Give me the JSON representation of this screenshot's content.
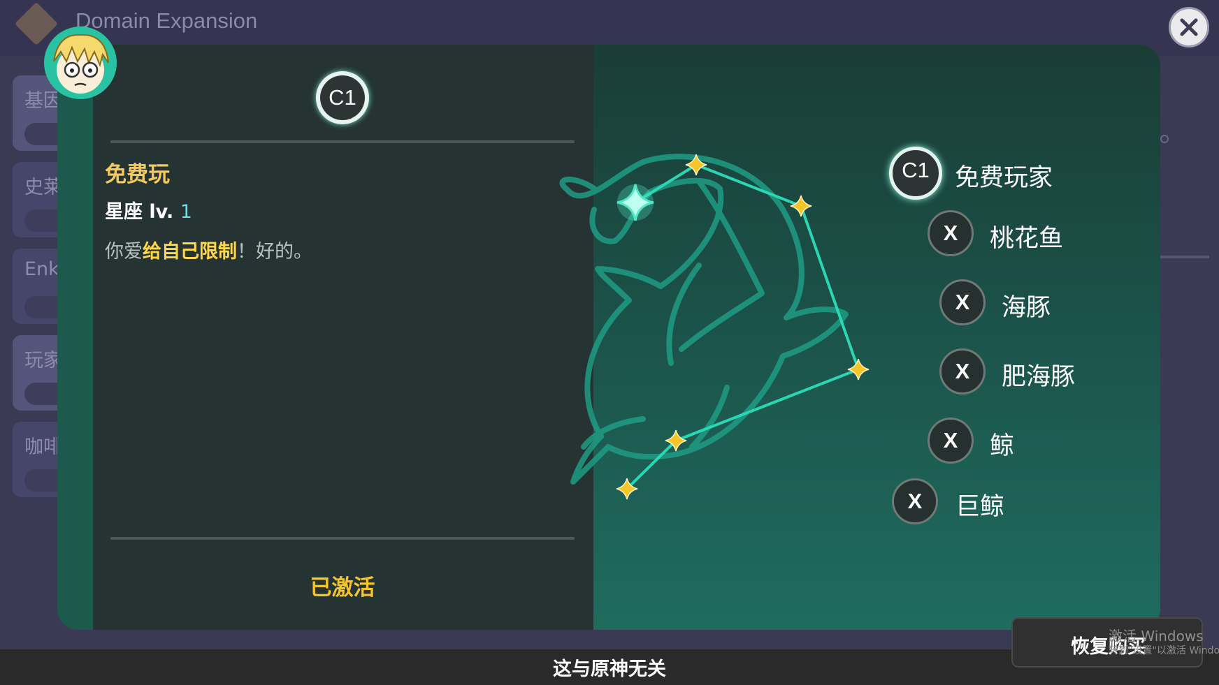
{
  "app": {
    "title": "Domain Expansion"
  },
  "sidebar": {
    "items": [
      {
        "label": "基因"
      },
      {
        "label": "史莱"
      },
      {
        "label": "Enk"
      },
      {
        "label": "玩家"
      },
      {
        "label": "咖啡"
      }
    ]
  },
  "detail": {
    "badge": "C1",
    "name": "免费玩",
    "level_label": "星座 lv.",
    "level_value": "1",
    "description": {
      "pre": "你爱",
      "highlight": "给自己限制",
      "post": "！好的。"
    },
    "status": "已激活"
  },
  "constellations": [
    {
      "badge": "C1",
      "label": "免费玩家",
      "active": true
    },
    {
      "badge": "X",
      "label": "桃花鱼",
      "active": false
    },
    {
      "badge": "X",
      "label": "海豚",
      "active": false
    },
    {
      "badge": "X",
      "label": "肥海豚",
      "active": false
    },
    {
      "badge": "X",
      "label": "鲸",
      "active": false
    },
    {
      "badge": "X",
      "label": "巨鲸",
      "active": false
    }
  ],
  "footer": {
    "text": "这与原神无关"
  },
  "restore_button": {
    "label": "恢复购买"
  },
  "watermark": {
    "line1": "激活 Windows",
    "line2": "转到\"设置\"以激活 Windows。"
  },
  "colors": {
    "accent": "#1d5a4e",
    "gold": "#f7c42c",
    "name": "#f4c95e",
    "teal_line": "#2ab89a"
  }
}
